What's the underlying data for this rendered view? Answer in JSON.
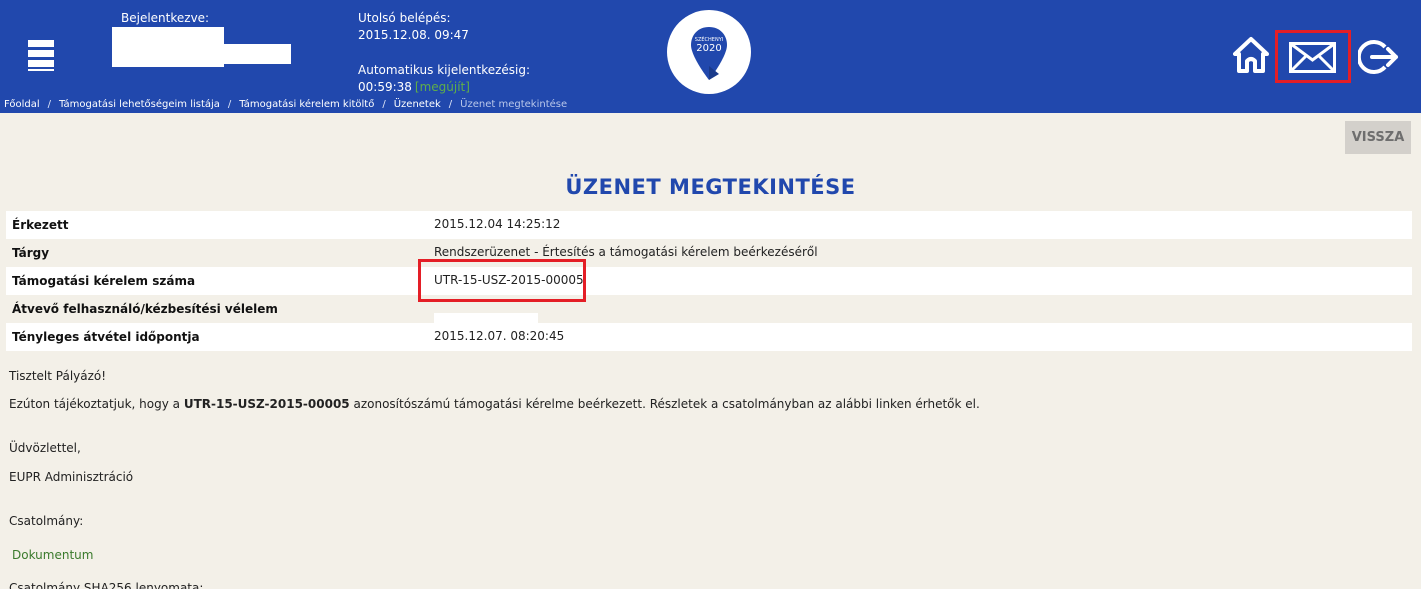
{
  "header": {
    "logged_in_label": "Bejelentkezve:",
    "last_login_label": "Utolsó belépés:",
    "last_login_value": "2015.12.08. 09:47",
    "auto_logout_label": "Automatikus kijelentkezésig:",
    "auto_logout_value": "00:59:38",
    "auto_logout_renew": "[megújít]",
    "logo_text": "SZÉCHENYI",
    "logo_year": "2020"
  },
  "breadcrumb": [
    "Főoldal",
    "Támogatási lehetőségeim listája",
    "Támogatási kérelem kitöltő",
    "Üzenetek",
    "Üzenet megtekintése"
  ],
  "back_button": "VISSZA",
  "page_title": "ÜZENET MEGTEKINTÉSE",
  "info_rows": [
    {
      "label": "Érkezett",
      "value": "2015.12.04 14:25:12"
    },
    {
      "label": "Tárgy",
      "value": "Rendszerüzenet - Értesítés a támogatási kérelem beérkezéséről"
    },
    {
      "label": "Támogatási kérelem száma",
      "value": "UTR-15-USZ-2015-00005"
    },
    {
      "label": "Átvevő felhasználó/kézbesítési vélelem",
      "value": ""
    },
    {
      "label": "Tényleges átvétel időpontja",
      "value": "2015.12.07. 08:20:45"
    }
  ],
  "message": {
    "greeting": "Tisztelt Pályázó!",
    "body_before": "Ezúton tájékoztatjuk, hogy a ",
    "body_bold": "UTR-15-USZ-2015-00005",
    "body_after": " azonosítószámú támogatási kérelme beérkezett. Részletek a csatolmányban az alábbi linken érhetők el.",
    "closing": "Üdvözlettel,",
    "signature": "EUPR Adminisztráció",
    "attachment_label": "Csatolmány:",
    "attachment_link": "Dokumentum",
    "hash_label": "Csatolmány SHA256 lenyomata:"
  },
  "colors": {
    "header_bg": "#2148ad",
    "page_bg": "#f3f0e8",
    "highlight": "#e41e26",
    "link": "#3a7a2c",
    "renew": "#5fae4a"
  },
  "icons": [
    "menu-icon",
    "logo-pin-icon",
    "home-icon",
    "mail-icon",
    "logout-icon"
  ]
}
